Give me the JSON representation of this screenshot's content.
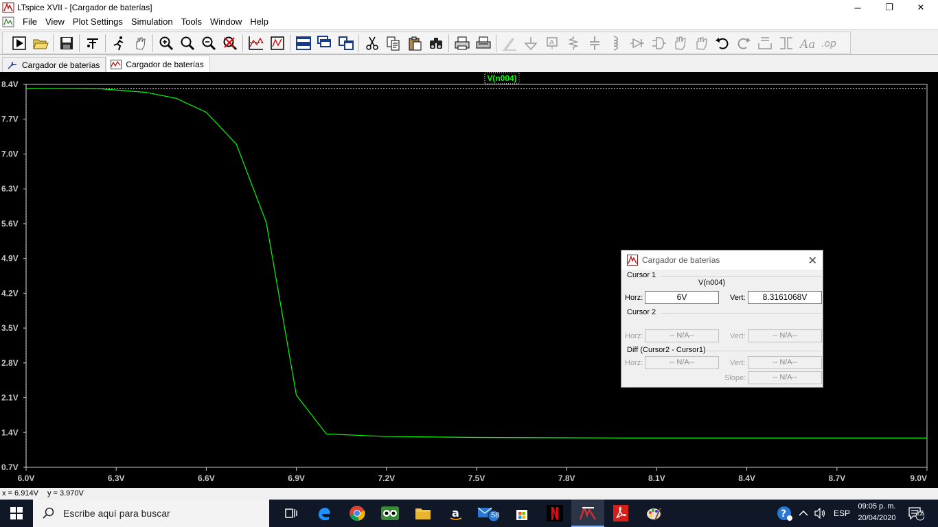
{
  "window": {
    "title": "LTspice XVII - [Cargador de baterías]",
    "controls": {
      "minimize": "─",
      "restore": "❐",
      "close": "✕"
    }
  },
  "menu": {
    "items": [
      "File",
      "View",
      "Plot Settings",
      "Simulation",
      "Tools",
      "Window",
      "Help"
    ],
    "mdi_controls": {
      "minimize": "–",
      "restore": "🗗",
      "close": "✕"
    }
  },
  "toolbar": {
    "groups": [
      [
        "run-icon",
        "open-icon"
      ],
      [
        "save-icon"
      ],
      [
        "control-panel-icon"
      ],
      [
        "runner-icon",
        "pan-hand-icon"
      ],
      [
        "zoom-in-icon",
        "zoom-area-icon",
        "zoom-out-icon",
        "zoom-cancel-icon"
      ],
      [
        "autorange-icon",
        "fit-icon"
      ],
      [
        "tile-horizontal-icon",
        "cascade-icon",
        "tile-vertical-icon"
      ],
      [
        "cut-icon",
        "copy-icon",
        "paste-icon",
        "find-icon"
      ],
      [
        "print-icon",
        "print-setup-icon"
      ],
      [
        "draw-wire-icon",
        "ground-icon",
        "label-net-icon",
        "resistor-icon",
        "capacitor-icon",
        "inductor-icon",
        "diode-icon",
        "component-icon",
        "move-icon",
        "drag-icon",
        "undo-icon",
        "redo-icon",
        "rotate-icon",
        "mirror-icon",
        "text-icon",
        "spice-directive-icon"
      ]
    ]
  },
  "tabs": [
    {
      "label": "Cargador de baterías",
      "icon": "schematic-icon",
      "active": false
    },
    {
      "label": "Cargador de baterías",
      "icon": "waveform-icon",
      "active": true
    }
  ],
  "plot": {
    "trace_label": "V(n004)",
    "trace_color": "#00ff00",
    "background": "#000000"
  },
  "chart_data": {
    "type": "line",
    "title": "V(n004)",
    "xlabel": "",
    "ylabel": "",
    "xlim": [
      6.0,
      9.0
    ],
    "ylim": [
      0.7,
      8.4
    ],
    "x_ticks": [
      "6.0V",
      "6.3V",
      "6.6V",
      "6.9V",
      "7.2V",
      "7.5V",
      "7.8V",
      "8.1V",
      "8.4V",
      "8.7V",
      "9.0V"
    ],
    "y_ticks": [
      "8.4V",
      "7.7V",
      "7.0V",
      "6.3V",
      "5.6V",
      "4.9V",
      "4.2V",
      "3.5V",
      "2.8V",
      "2.1V",
      "1.4V",
      "0.7V"
    ],
    "series": [
      {
        "name": "V(n004)",
        "color": "#00ff00",
        "x": [
          6.0,
          6.25,
          6.4,
          6.5,
          6.6,
          6.7,
          6.8,
          6.9,
          7.0,
          7.2,
          7.5,
          8.0,
          9.0
        ],
        "y": [
          8.32,
          8.31,
          8.24,
          8.12,
          7.84,
          7.2,
          5.62,
          2.15,
          1.37,
          1.32,
          1.3,
          1.29,
          1.29
        ]
      }
    ],
    "cursor": {
      "x": 6.0,
      "y": 8.316,
      "style": "dashed",
      "color": "#ffffff"
    },
    "grid": false
  },
  "status": {
    "x": "x = 6.914V",
    "y": "y = 3.970V"
  },
  "cursor_dialog": {
    "title": "Cargador de baterías",
    "cursor1_label": "Cursor 1",
    "trace_name": "V(n004)",
    "horz_label": "Horz:",
    "horz_value": "6V",
    "vert_label": "Vert:",
    "vert_value": "8.3161068V",
    "cursor2_label": "Cursor 2",
    "c2_horz_label": "Horz:",
    "c2_horz_value": "-- N/A--",
    "c2_vert_label": "Vert:",
    "c2_vert_value": "-- N/A--",
    "diff_label": "Diff (Cursor2 - Cursor1)",
    "diff_horz_label": "Horz:",
    "diff_horz_value": "-- N/A--",
    "diff_vert_label": "Vert:",
    "diff_vert_value": "-- N/A--",
    "slope_label": "Slope:",
    "slope_value": "-- N/A--"
  },
  "taskbar": {
    "search_placeholder": "Escribe aquí para buscar",
    "mail_badge": "58",
    "language": "ESP",
    "time": "09:05 p. m.",
    "date": "20/04/2020",
    "notification_count": "12"
  }
}
